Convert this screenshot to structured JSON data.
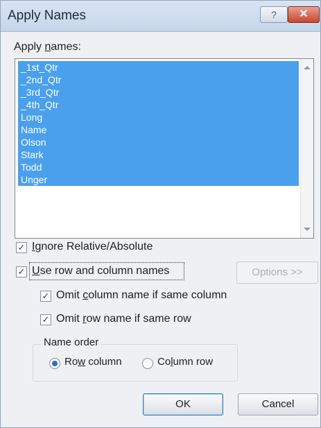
{
  "dialog": {
    "title": "Apply Names",
    "help_label": "?",
    "close_label": "✕",
    "apply_names_label_pre": "Apply ",
    "apply_names_label_u": "n",
    "apply_names_label_post": "ames:",
    "names": [
      "_1st_Qtr",
      "_2nd_Qtr",
      "_3rd_Qtr",
      "_4th_Qtr",
      "Long",
      "Name",
      "Olson",
      "Stark",
      "Todd",
      "Unger"
    ],
    "selected_names": [
      "_1st_Qtr",
      "_2nd_Qtr",
      "_3rd_Qtr",
      "_4th_Qtr",
      "Long",
      "Name",
      "Olson",
      "Stark",
      "Todd",
      "Unger"
    ],
    "ignore_relative": {
      "checked": true,
      "label_u": "I",
      "label_post": "gnore Relative/Absolute"
    },
    "use_row_column": {
      "checked": true,
      "label_u": "U",
      "label_post": "se row and column names"
    },
    "options_button": "Options >>",
    "omit_column": {
      "checked": true,
      "label_pre": "Omit ",
      "label_u": "c",
      "label_post": "olumn name if same column"
    },
    "omit_row": {
      "checked": true,
      "label_pre": "Omit ",
      "label_u": "r",
      "label_post": "ow name if same row"
    },
    "name_order": {
      "title": "Name order",
      "row_column": {
        "pre": "Ro",
        "u": "w",
        "post": " column",
        "selected": true
      },
      "column_row": {
        "pre": "Co",
        "u": "l",
        "post": "umn row",
        "selected": false
      }
    },
    "ok_button": "OK",
    "cancel_button": "Cancel",
    "check_mark": "✓"
  }
}
